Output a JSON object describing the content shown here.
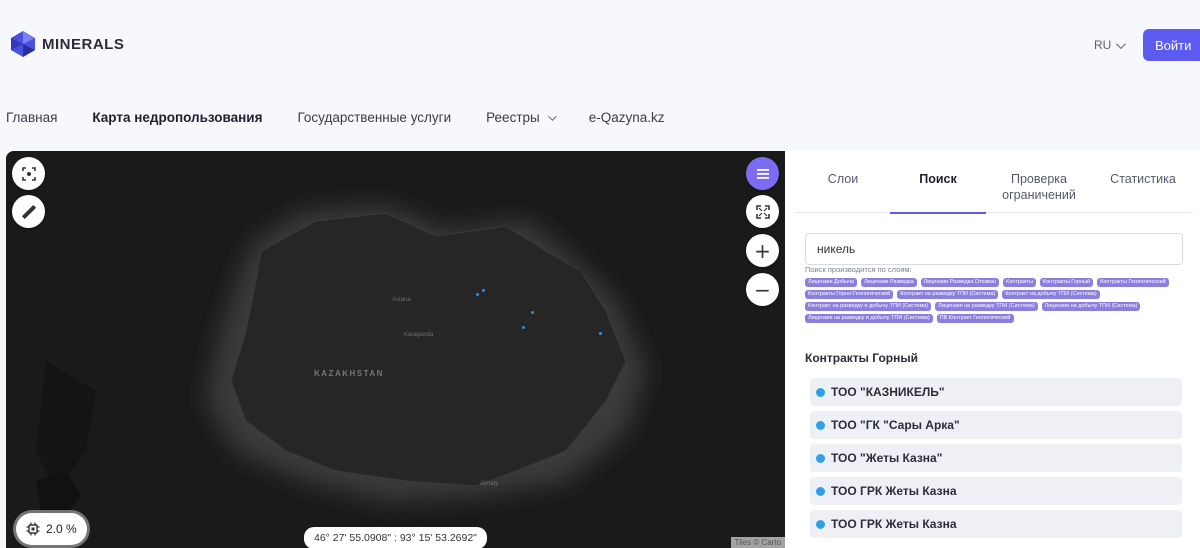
{
  "header": {
    "logo_text": "MINERALS",
    "lang": "RU",
    "login_label": "Войти",
    "accent_color": "#5b5bf0"
  },
  "nav": {
    "items": [
      {
        "label": "Главная"
      },
      {
        "label": "Карта недропользования",
        "active": true
      },
      {
        "label": "Государственные услуги"
      },
      {
        "label": "Реестры",
        "has_dropdown": true
      },
      {
        "label": "e-Qazyna.kz"
      }
    ]
  },
  "map": {
    "country_label": "KAZAKHSTAN",
    "city_labels": [
      "Astana",
      "Karaganda",
      "Almaty"
    ],
    "zoom_value": "2.0 %",
    "coordinates": "46° 27' 55.0908\" : 93° 15' 53.2692\"",
    "attribution": "Tiles © Carto"
  },
  "panel": {
    "tabs": [
      "Слои",
      "Поиск",
      "Проверка ограничений",
      "Статистика"
    ],
    "active_tab": "Поиск",
    "search_value": "никель",
    "search_hint": "Поиск производится по слоям:",
    "layer_chips": [
      "Лицензии Добыча",
      "Лицензии Разведка",
      "Лицензии Разведка Отозван",
      "Контракты",
      "Контракты Горный",
      "Контракты Геологический",
      "Контракты Горно-Геологический",
      "Контракт на разведку ТПИ (Система)",
      "Контракт на добычу ТПИ (Система)",
      "Контракт на разведку и добычу ТПИ (Система)",
      "Лицензия на разведку ТПИ (Система)",
      "Лицензия на добычу ТПИ (Система)",
      "Лицензия на разведку и добычу ТПИ (Система)",
      "ПВ Контракт Геологический"
    ],
    "section_title": "Контракты Горный",
    "results": [
      "ТОО \"КАЗНИКЕЛЬ\"",
      "ТОО \"ГК \"Сары Арка\"",
      "ТОО \"Жеты Казна\"",
      "ТОО ГРК Жеты Казна",
      "ТОО ГРК Жеты Казна"
    ]
  }
}
